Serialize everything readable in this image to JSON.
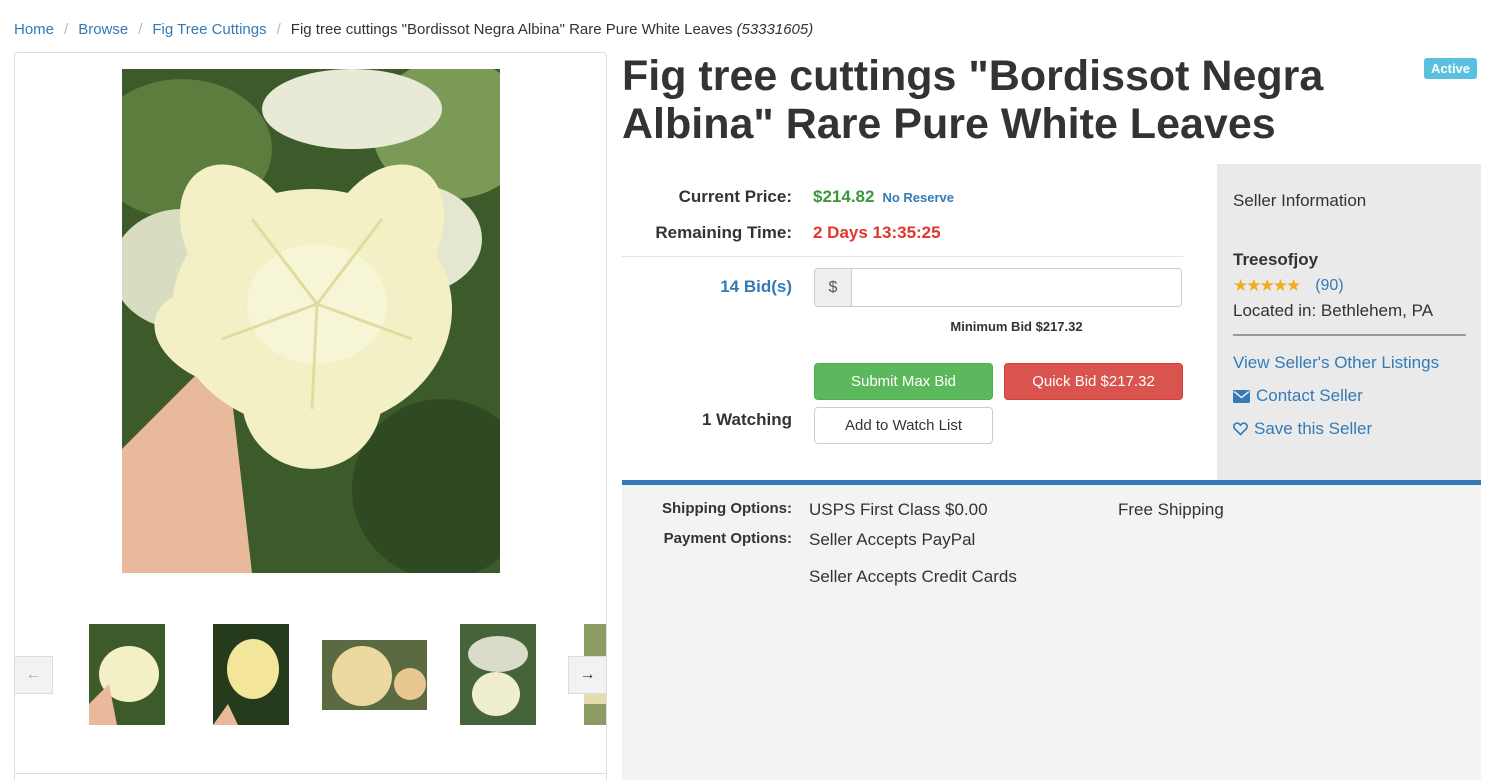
{
  "breadcrumb": {
    "home": "Home",
    "browse": "Browse",
    "category": "Fig Tree Cuttings",
    "current": "Fig tree cuttings \"Bordissot Negra Albina\" Rare Pure White Leaves",
    "lot_id": "(53331605)"
  },
  "listing": {
    "title": "Fig tree cuttings \"Bordissot Negra Albina\" Rare Pure White Leaves",
    "status": "Active"
  },
  "bidding": {
    "current_price_label": "Current Price:",
    "current_price": "$214.82",
    "reserve_note": "No Reserve",
    "remaining_label": "Remaining Time:",
    "remaining_time": "2 Days 13:35:25",
    "bids_count": "14 Bid(s)",
    "currency_symbol": "$",
    "bid_input_value": "",
    "minimum_bid": "Minimum Bid $217.32",
    "submit_label": "Submit Max Bid",
    "quick_bid_label": "Quick Bid $217.32",
    "watching": "1 Watching",
    "watch_label": "Add to Watch List"
  },
  "seller": {
    "heading": "Seller Information",
    "name": "Treesofjoy",
    "stars": "★★★★★",
    "rating_count": "(90)",
    "location": "Located in: Bethlehem, PA",
    "other_listings": "View Seller's Other Listings",
    "contact": "Contact Seller",
    "save": "Save this Seller"
  },
  "options": {
    "shipping_label": "Shipping Options:",
    "shipping_method": "USPS First Class $0.00",
    "shipping_note": "Free Shipping",
    "payment_label": "Payment Options:",
    "payment_1": "Seller Accepts PayPal",
    "payment_2": "Seller Accepts Credit Cards"
  },
  "colors": {
    "link": "#337ab7",
    "price": "#3c963c",
    "time": "#e0362c",
    "submit": "#5cb85c",
    "quick_bid": "#d9534f",
    "badge": "#5bc0de"
  },
  "icons": {
    "prev": "arrow-left-icon",
    "next": "arrow-right-icon",
    "contact": "envelope-icon",
    "save": "heart-outline-icon",
    "rating": "star-icon"
  }
}
